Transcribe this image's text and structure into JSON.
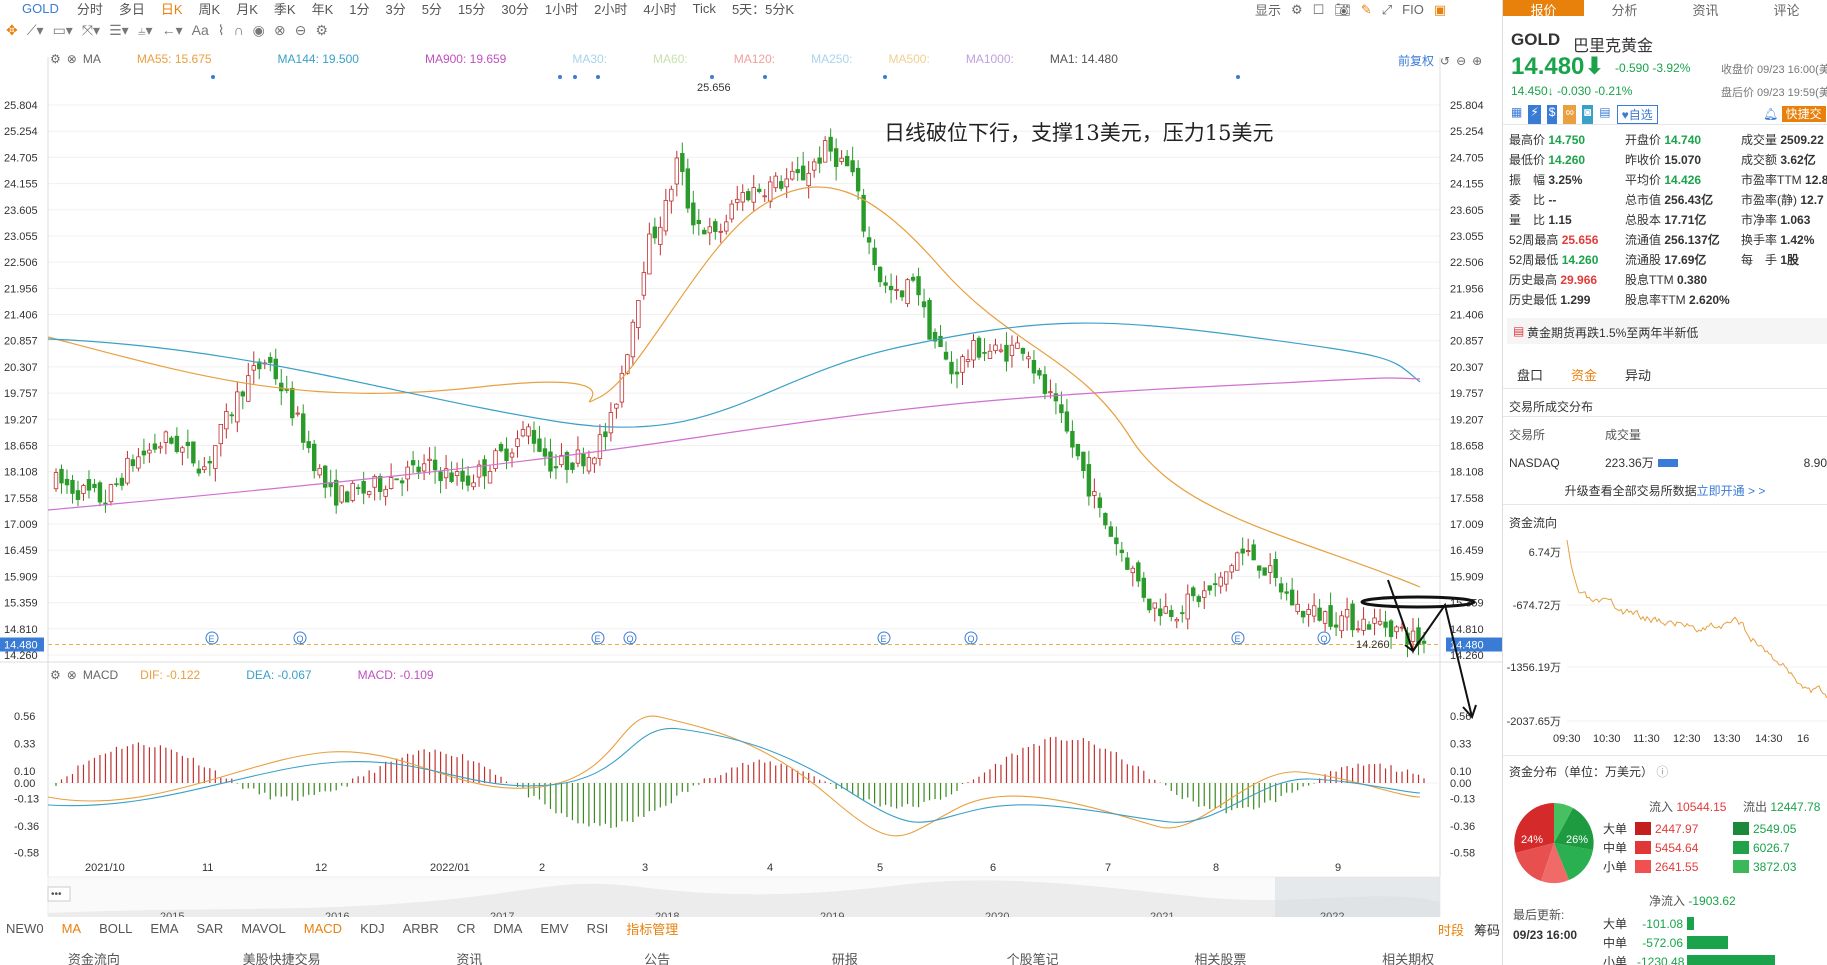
{
  "toolbar": {
    "symbol": "GOLD",
    "periods": [
      "分时",
      "多日",
      "日K",
      "周K",
      "月K",
      "季K",
      "年K",
      "1分",
      "3分",
      "5分",
      "15分",
      "30分",
      "1小时",
      "2小时",
      "4小时",
      "Tick",
      "5天：5分K"
    ],
    "selected": "日K",
    "display": "显示",
    "fio": "FIO"
  },
  "main": {
    "ma_label": "MA",
    "ma55": "MA55: 15.675",
    "ma144": "MA144: 19.500",
    "ma900": "MA900: 19.659",
    "ma30": "MA30:",
    "ma60": "MA60:",
    "ma120": "MA120:",
    "ma250": "MA250:",
    "ma500": "MA500:",
    "ma1000": "MA1000:",
    "ma1": "MA1: 14.480",
    "adjust": "前复权",
    "price_ticks": [
      "25.804",
      "25.254",
      "24.705",
      "24.155",
      "23.605",
      "23.055",
      "22.506",
      "21.956",
      "21.406",
      "20.857",
      "20.307",
      "19.757",
      "19.207",
      "18.658",
      "18.108",
      "17.558",
      "17.009",
      "16.459",
      "15.909",
      "15.359",
      "14.810",
      "14.480",
      "14.260"
    ],
    "high_label": "25.656",
    "low_label": "14.260",
    "last_price": "14.480",
    "annotation": "日线破位下行，支撑13美元，压力15美元",
    "macd_label": "MACD",
    "dif": "DIF: -0.122",
    "dea": "DEA: -0.067",
    "macd": "MACD: -0.109",
    "macd_ticks": [
      "0.56",
      "0.33",
      "0.10",
      "0.00",
      "-0.13",
      "-0.36",
      "-0.58"
    ],
    "macd_left_ticks": [
      "0.56",
      "0.33",
      "0.10",
      "0.00",
      "-0.13",
      "-0.36",
      "-0.58"
    ],
    "macd_right_ticks": [
      "0.56",
      "0.33",
      "0.10",
      "0.00",
      "-0.13",
      "-0.36",
      "-0.58"
    ],
    "months": [
      "2021/10",
      "11",
      "12",
      "2022/01",
      "2",
      "3",
      "4",
      "5",
      "6",
      "7",
      "8",
      "9"
    ],
    "years": [
      "2015",
      "2016",
      "2017",
      "2018",
      "2019",
      "2020",
      "2021",
      "2022"
    ]
  },
  "indicators": [
    "NEW0",
    "MA",
    "BOLL",
    "EMA",
    "SAR",
    "MAVOL",
    "MACD",
    "KDJ",
    "ARBR",
    "CR",
    "DMA",
    "EMV",
    "RSI",
    "指标管理"
  ],
  "indicators_selected": "MACD",
  "indicator_right": [
    "时段",
    "筹码"
  ],
  "bottom_tabs": [
    "资金流向",
    "美股快捷交易",
    "资讯",
    "公告",
    "研报",
    "个股笔记",
    "相关股票",
    "相关期权"
  ],
  "right": {
    "tabs": [
      "报价",
      "分析",
      "资讯",
      "评论"
    ],
    "selected": "报价",
    "code": "GOLD",
    "name": "巴里克黄金",
    "price": "14.480",
    "change": "-0.590",
    "pct": "-3.92%",
    "close_label": "收盘价 09/23 16:00(美",
    "after_price": "14.450",
    "after_change": "-0.030",
    "after_pct": "-0.21%",
    "after_label": "盘后价 09/23 19:59(美",
    "watch": "自选",
    "fast": "快捷交",
    "quote": [
      [
        "最高价",
        "14.750",
        "开盘价",
        "14.740",
        "成交量",
        "2509.22"
      ],
      [
        "最低价",
        "14.260",
        "昨收价",
        "15.070",
        "成交额",
        "3.62亿"
      ],
      [
        "振　幅",
        "3.25%",
        "平均价",
        "14.426",
        "市盈率TTM",
        "12.8"
      ],
      [
        "委　比",
        "--",
        "总市值",
        "256.43亿",
        "市盈率(静)",
        "12.7"
      ],
      [
        "量　比",
        "1.15",
        "总股本",
        "17.71亿",
        "市净率",
        "1.063"
      ],
      [
        "52周最高",
        "25.656",
        "流通值",
        "256.137亿",
        "换手率",
        "1.42%"
      ],
      [
        "52周最低",
        "14.260",
        "流通股",
        "17.69亿",
        "每　手",
        "1股"
      ],
      [
        "历史最高",
        "29.966",
        "股息TTM",
        "0.380",
        "",
        ""
      ],
      [
        "历史最低",
        "1.299",
        "股息率TTM",
        "2.620%",
        "",
        ""
      ]
    ],
    "news": "黄金期货再跌1.5%至两年半新低",
    "subtabs": [
      "盘口",
      "资金",
      "异动"
    ],
    "subtab_selected": "资金",
    "exch_title": "交易所成交分布",
    "exch_cols": [
      "交易所",
      "成交量",
      ""
    ],
    "exch_name": "NASDAQ",
    "exch_vol": "223.36万",
    "exch_val": "8.90",
    "upgrade": "升级查看全部交易所数据",
    "upgrade_link": "立即开通 > >",
    "flow_title": "资金流向",
    "flow_ticks": [
      "6.74万",
      "-674.72万",
      "-1356.19万",
      "-2037.65万"
    ],
    "flow_times": [
      "09:30",
      "10:30",
      "11:30",
      "12:30",
      "13:30",
      "14:30",
      "16"
    ],
    "dist_title": "资金分布（单位：万美元）",
    "pie_left": "24%",
    "pie_right": "26%",
    "in_label": "流入",
    "in_total": "10544.15",
    "out_label": "流出",
    "out_total": "12447.78",
    "rows": [
      [
        "大单",
        "2447.97",
        "2549.05"
      ],
      [
        "中单",
        "5454.64",
        "6026.7"
      ],
      [
        "小单",
        "2641.55",
        "3872.03"
      ]
    ],
    "net_label": "净流入",
    "net": "-1903.62",
    "updated_label": "最后更新:",
    "updated": "09/23 16:00",
    "net_rows": [
      [
        "大单",
        "-101.08"
      ],
      [
        "中单",
        "-572.06"
      ],
      [
        "小单",
        "-1230.48"
      ]
    ]
  }
}
